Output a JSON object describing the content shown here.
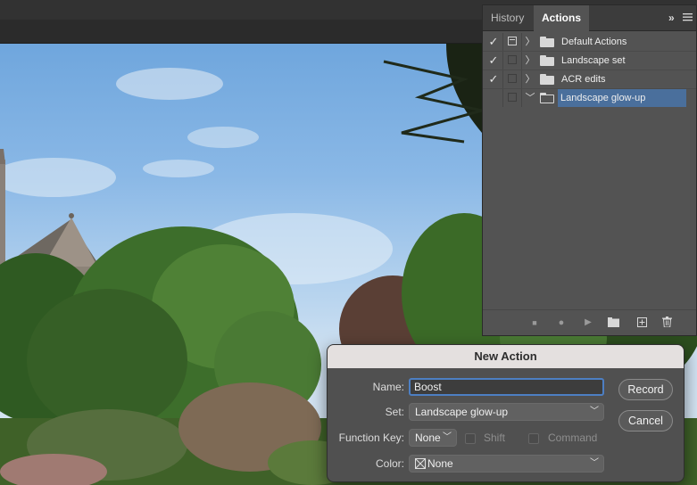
{
  "panel": {
    "tabs": [
      {
        "label": "History",
        "active": false
      },
      {
        "label": "Actions",
        "active": true
      }
    ],
    "collapse_glyph": "»",
    "menu_icon": "hamburger-icon",
    "sets": [
      {
        "label": "Default Actions",
        "checked": true,
        "dialog": true,
        "expanded": false,
        "selected": false
      },
      {
        "label": "Landscape set",
        "checked": true,
        "dialog": false,
        "expanded": false,
        "selected": false
      },
      {
        "label": "ACR edits",
        "checked": true,
        "dialog": false,
        "expanded": false,
        "selected": false
      },
      {
        "label": "Landscape glow-up",
        "checked": false,
        "dialog": false,
        "expanded": true,
        "selected": true
      }
    ],
    "footer": {
      "stop": "■",
      "record": "●",
      "play": "▶",
      "new_set": "folder-icon",
      "new_action": "plus-square-icon",
      "delete": "trash-icon"
    }
  },
  "dialog": {
    "title": "New Action",
    "name_label": "Name:",
    "name_value": "Boost",
    "set_label": "Set:",
    "set_value": "Landscape glow-up",
    "function_key_label": "Function Key:",
    "function_key_value": "None",
    "shift_label": "Shift",
    "command_label": "Command",
    "color_label": "Color:",
    "color_value": "None",
    "record_button": "Record",
    "cancel_button": "Cancel"
  },
  "colors": {
    "accent": "#4a6f9c",
    "focus": "#4d7fc3",
    "panel": "#535353",
    "dialog": "#505050"
  }
}
